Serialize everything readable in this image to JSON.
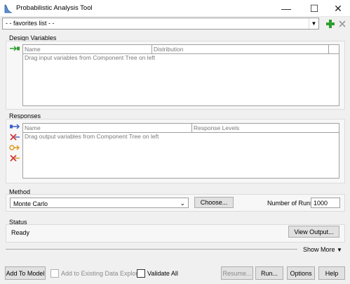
{
  "window": {
    "title": "Probabilistic Analysis Tool",
    "controls": {
      "minimize": "—",
      "maximize": "☐",
      "close": "✕"
    }
  },
  "favorites": {
    "value": "- -  favorites list  - -",
    "add_icon": "plus-icon",
    "delete_icon": "x-icon"
  },
  "design_variables": {
    "title": "Design Variables",
    "columns": [
      "Name",
      "Distribution"
    ],
    "hint": "Drag input variables from Component Tree on left"
  },
  "responses": {
    "title": "Responses",
    "columns": [
      "Name",
      "Response Levels"
    ],
    "hint": "Drag output variables from Component Tree on left"
  },
  "method": {
    "title": "Method",
    "selected": "Monte Carlo",
    "choose_label": "Choose...",
    "runs_label": "Number of Runs:",
    "runs_value": "1000"
  },
  "status": {
    "title": "Status",
    "text": "Ready",
    "view_output_label": "View Output..."
  },
  "show_more_label": "Show More",
  "footer": {
    "add_to_model": "Add To Model",
    "add_existing": "Add to Existing Data Explorer",
    "validate_all": "Validate All",
    "resume": "Resume...",
    "run": "Run...",
    "options": "Options",
    "help": "Help"
  },
  "colors": {
    "accent_green": "#2e9e2e",
    "accent_blue": "#3a5fcd",
    "accent_red": "#d03030",
    "accent_orange": "#e09a1a"
  }
}
